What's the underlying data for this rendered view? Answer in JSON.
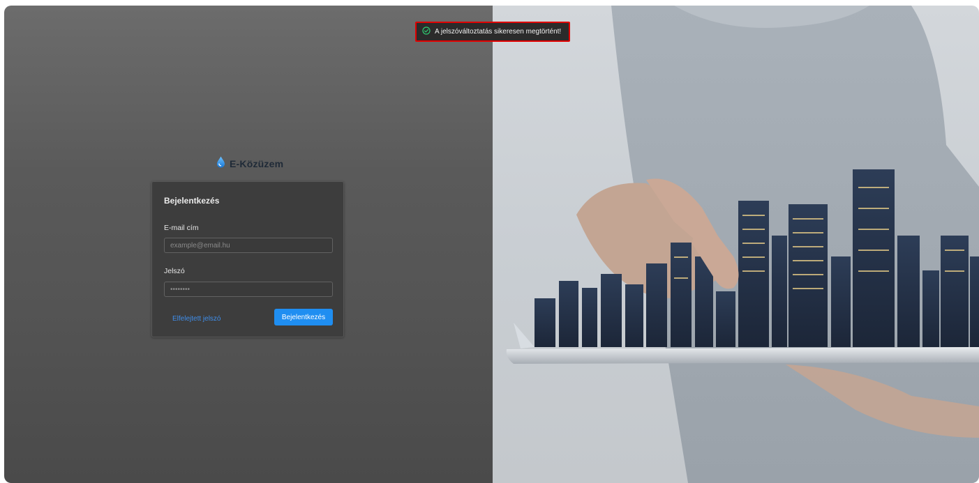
{
  "app": {
    "brand_name": "E-Közüzem"
  },
  "toast": {
    "message": "A jelszóváltoztatás sikeresen megtörtént!"
  },
  "login_form": {
    "title": "Bejelentkezés",
    "email_label": "E-mail cím",
    "email_placeholder": "example@email.hu",
    "email_value": "",
    "password_label": "Jelszó",
    "password_placeholder": "••••••••",
    "password_value": "",
    "forgot_password_label": "Elfelejtett jelszó",
    "submit_label": "Bejelentkezés"
  },
  "colors": {
    "accent": "#1f8ef1",
    "link": "#3f8eea",
    "toast_border": "#e00000",
    "toast_success_icon": "#2ecc71"
  },
  "icons": {
    "brand": "water-drop-icon",
    "toast": "check-circle-icon"
  }
}
